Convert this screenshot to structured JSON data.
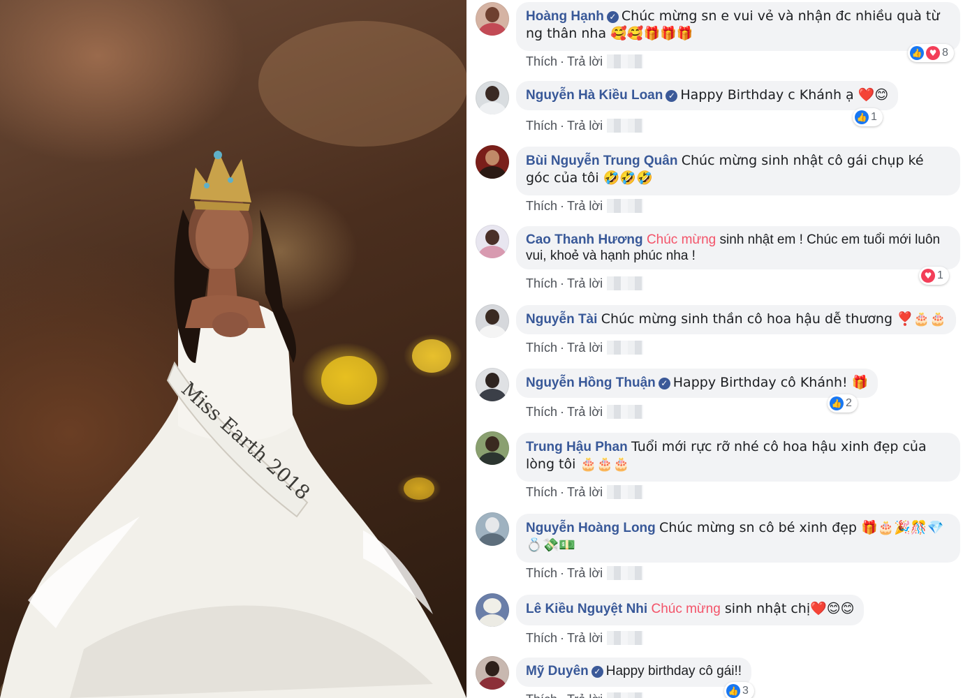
{
  "photo": {
    "sash_text": "Miss Earth 2018"
  },
  "colors": {
    "author": "#385898",
    "tag": "#f35369",
    "bubble": "#f2f3f5",
    "like": "#1877f2",
    "love": "#f33e58"
  },
  "actions": {
    "like_label": "Thích",
    "reply_label": "Trả lời",
    "separator": "·"
  },
  "comments": [
    {
      "author": "Hoàng Hạnh",
      "verified": true,
      "text": "Chúc mừng sn e vui vẻ và nhận đc nhiều quà từ ng thân nha 🥰🥰🎁🎁🎁",
      "reactions": {
        "icons": [
          "like-icon",
          "love-icon"
        ],
        "count": "8"
      }
    },
    {
      "author": "Nguyễn Hà Kiều Loan",
      "verified": true,
      "text": "Happy Birthday c Khánh ạ ❤️😊",
      "reactions": {
        "icons": [
          "like-icon"
        ],
        "count": "1"
      }
    },
    {
      "author": "Bùi Nguyễn Trung Quân",
      "verified": false,
      "text": "Chúc mừng sinh nhật cô gái chụp ké góc của tôi 🤣🤣🤣"
    },
    {
      "author": "Cao Thanh Hương",
      "verified": false,
      "tag": "Chúc mừng",
      "text": " sinh nhật em ! Chúc em tuổi mới luôn vui, khoẻ và hạnh phúc nha !",
      "reactions": {
        "icons": [
          "love-icon"
        ],
        "count": "1"
      }
    },
    {
      "author": "Nguyễn Tài",
      "verified": false,
      "text": "Chúc mừng sinh thần cô hoa hậu dễ thương ❣️🎂🎂"
    },
    {
      "author": "Nguyễn Hồng Thuận",
      "verified": true,
      "text": "Happy Birthday cô Khánh! 🎁",
      "reactions": {
        "icons": [
          "like-icon"
        ],
        "count": "2"
      }
    },
    {
      "author": "Trung Hậu Phan",
      "verified": false,
      "text": "Tuổi mới rực rỡ nhé cô hoa hậu xinh đẹp của lòng tôi 🎂🎂🎂"
    },
    {
      "author": "Nguyễn Hoàng Long",
      "verified": false,
      "text": "Chúc mừng sn cô bé xinh đẹp 🎁🎂🎉🎊💎💍💸💵"
    },
    {
      "author": "Lê Kiều Nguyệt Nhi",
      "verified": false,
      "tag": "Chúc mừng",
      "text": " sinh nhật chị❤️😊😊"
    },
    {
      "author": "Mỹ Duyên",
      "verified": true,
      "text": "Happy birthday cô gái!!",
      "reactions": {
        "icons": [
          "like-icon"
        ],
        "count": "3"
      }
    }
  ]
}
